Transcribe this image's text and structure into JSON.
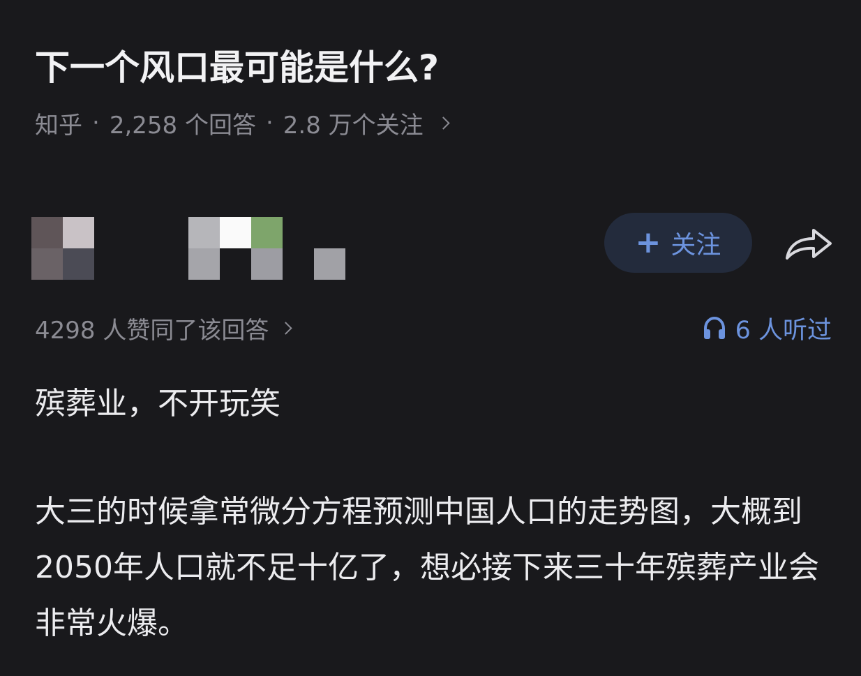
{
  "question": {
    "title": "下一个风口最可能是什么?",
    "source": "知乎",
    "answer_count": "2,258 个回答",
    "follower_count": "2.8 万个关注"
  },
  "author": {
    "follow_label": "关注",
    "pixelated_block_colors": [
      "#5f5558",
      "#c9c2c6",
      "#6a6266",
      "#4b4b55",
      "#b6b6ba",
      "#fafafa",
      "#7ea56b",
      "#a5a5aa",
      "#9d9da3",
      "#a1a1a6"
    ]
  },
  "answer": {
    "agree_text": "4298 人赞同了该回答",
    "listen_text": "6 人听过",
    "paragraphs": [
      "殡葬业，不开玩笑",
      "大三的时候拿常微分方程预测中国人口的走势图，大概到2050年人口就不足十亿了，想必接下来三十年殡葬产业会非常火爆。"
    ]
  },
  "colors": {
    "background": "#19191c",
    "accent_blue": "#6c93de",
    "muted_text": "#8b8b93"
  }
}
